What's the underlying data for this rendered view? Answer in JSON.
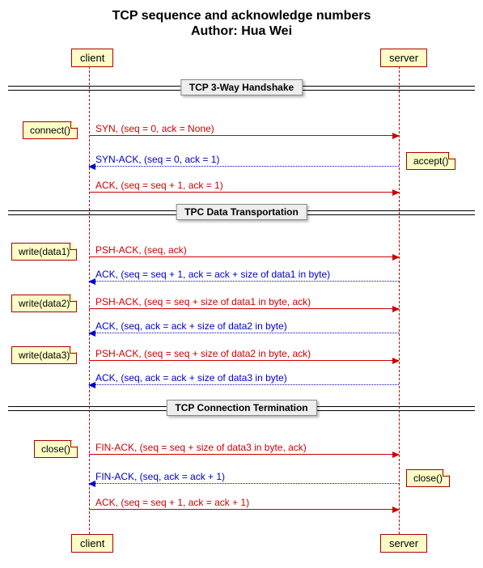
{
  "title_line1": "TCP sequence and acknowledge numbers",
  "title_line2": "Author: Hua Wei",
  "participants": {
    "client": "client",
    "server": "server"
  },
  "sections": {
    "handshake": "TCP 3-Way Handshake",
    "data": "TPC Data Transportation",
    "termination": "TCP Connection Termination"
  },
  "notes": {
    "connect": "connect()",
    "accept": "accept()",
    "write1": "write(data1)",
    "write2": "write(data2)",
    "write3": "write(data3)",
    "close_client": "close()",
    "close_server": "close()"
  },
  "messages": {
    "syn": "SYN, (seq = 0, ack = None)",
    "synack": "SYN-ACK, (seq = 0, ack = 1)",
    "ack1": "ACK, (seq = seq + 1, ack = 1)",
    "pshack1": "PSH-ACK, (seq, ack)",
    "ack_d1": "ACK, (seq = seq + 1, ack = ack + size of data1 in byte)",
    "pshack2": "PSH-ACK, (seq = seq + size of data1 in byte, ack)",
    "ack_d2": "ACK, (seq, ack = ack + size of data2 in byte)",
    "pshack3": "PSH-ACK, (seq = seq + size of data2 in byte, ack)",
    "ack_d3": "ACK, (seq, ack = ack + size of data3 in byte)",
    "finack1": "FIN-ACK, (seq = seq + size of data3 in byte, ack)",
    "finack2": "FIN-ACK, (seq, ack = ack + 1)",
    "ack_last": "ACK, (seq = seq + 1, ack = ack + 1)"
  },
  "chart_data": {
    "type": "sequence-diagram",
    "title": "TCP sequence and acknowledge numbers",
    "author": "Hua Wei",
    "participants": [
      "client",
      "server"
    ],
    "groups": [
      {
        "label": "TCP 3-Way Handshake",
        "events": [
          {
            "type": "note",
            "on": "client",
            "side": "left",
            "text": "connect()"
          },
          {
            "type": "message",
            "from": "client",
            "to": "server",
            "style": "solid",
            "color": "red",
            "text": "SYN, (seq = 0, ack = None)"
          },
          {
            "type": "note",
            "on": "server",
            "side": "right",
            "text": "accept()"
          },
          {
            "type": "message",
            "from": "server",
            "to": "client",
            "style": "dotted",
            "color": "blue",
            "text": "SYN-ACK, (seq = 0, ack = 1)"
          },
          {
            "type": "message",
            "from": "client",
            "to": "server",
            "style": "solid",
            "color": "red",
            "text": "ACK, (seq = seq + 1, ack = 1)"
          }
        ]
      },
      {
        "label": "TPC Data Transportation",
        "events": [
          {
            "type": "note",
            "on": "client",
            "side": "left",
            "text": "write(data1)"
          },
          {
            "type": "message",
            "from": "client",
            "to": "server",
            "style": "solid",
            "color": "red",
            "text": "PSH-ACK, (seq, ack)"
          },
          {
            "type": "message",
            "from": "server",
            "to": "client",
            "style": "dotted",
            "color": "blue",
            "text": "ACK, (seq = seq + 1, ack = ack + size of data1 in byte)"
          },
          {
            "type": "note",
            "on": "client",
            "side": "left",
            "text": "write(data2)"
          },
          {
            "type": "message",
            "from": "client",
            "to": "server",
            "style": "solid",
            "color": "red",
            "text": "PSH-ACK, (seq = seq + size of data1 in byte, ack)"
          },
          {
            "type": "message",
            "from": "server",
            "to": "client",
            "style": "dotted",
            "color": "blue",
            "text": "ACK, (seq, ack = ack + size of data2 in byte)"
          },
          {
            "type": "note",
            "on": "client",
            "side": "left",
            "text": "write(data3)"
          },
          {
            "type": "message",
            "from": "client",
            "to": "server",
            "style": "solid",
            "color": "red",
            "text": "PSH-ACK, (seq = seq + size of data2 in byte, ack)"
          },
          {
            "type": "message",
            "from": "server",
            "to": "client",
            "style": "dotted",
            "color": "blue",
            "text": "ACK, (seq, ack = ack + size of data3 in byte)"
          }
        ]
      },
      {
        "label": "TCP Connection Termination",
        "events": [
          {
            "type": "note",
            "on": "client",
            "side": "left",
            "text": "close()"
          },
          {
            "type": "message",
            "from": "client",
            "to": "server",
            "style": "solid",
            "color": "red",
            "text": "FIN-ACK, (seq = seq + size of data3 in byte, ack)"
          },
          {
            "type": "note",
            "on": "server",
            "side": "right",
            "text": "close()"
          },
          {
            "type": "message",
            "from": "server",
            "to": "client",
            "style": "dotted",
            "color": "blue",
            "text": "FIN-ACK, (seq, ack = ack + 1)"
          },
          {
            "type": "message",
            "from": "client",
            "to": "server",
            "style": "solid",
            "color": "red",
            "text": "ACK, (seq = seq + 1, ack = ack + 1)"
          }
        ]
      }
    ]
  }
}
